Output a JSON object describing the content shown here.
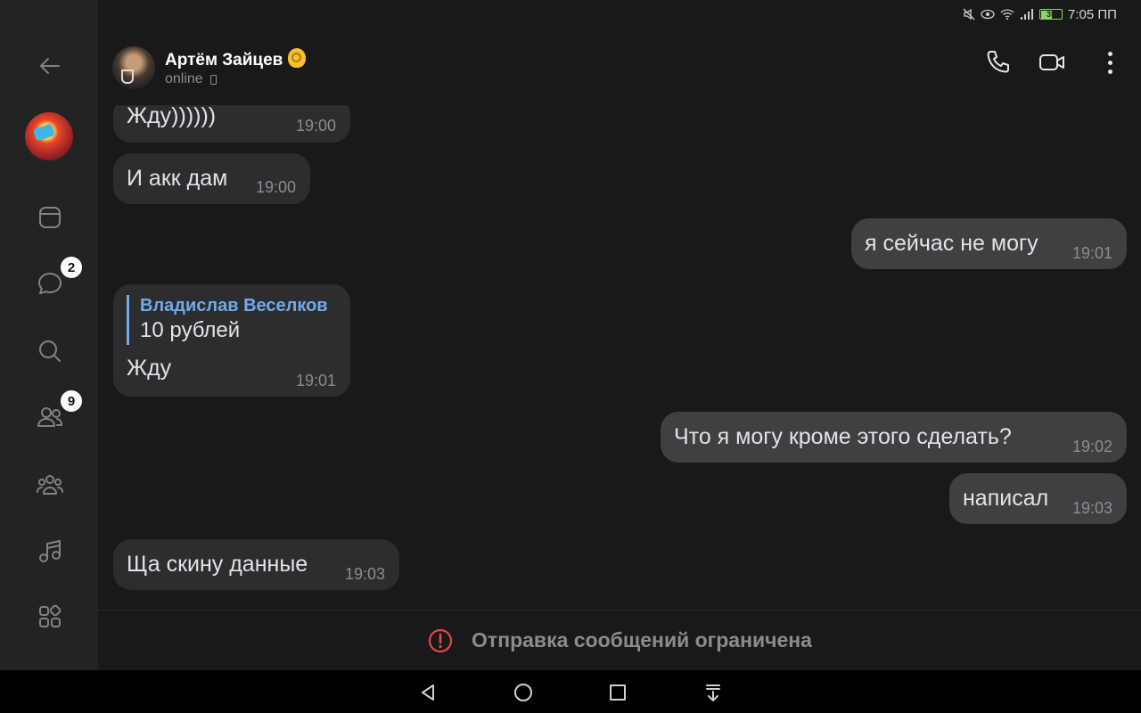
{
  "status_bar": {
    "time": "7:05 ПП",
    "battery": "35"
  },
  "header": {
    "name": "Артём Зайцев",
    "status": "online",
    "emoji_icon": "ok-hand-icon"
  },
  "rail": {
    "items": [
      {
        "icon": "back-arrow-icon"
      },
      {
        "icon": "profile-avatar"
      },
      {
        "icon": "news-feed-icon"
      },
      {
        "icon": "messages-icon",
        "badge": "2"
      },
      {
        "icon": "search-icon"
      },
      {
        "icon": "friends-icon",
        "badge": "9"
      },
      {
        "icon": "communities-icon"
      },
      {
        "icon": "music-icon"
      },
      {
        "icon": "services-icon"
      }
    ]
  },
  "messages": [
    {
      "dir": "in",
      "text": "Жду))))))",
      "time": "19:00"
    },
    {
      "dir": "in",
      "text": "И акк дам",
      "time": "19:00"
    },
    {
      "dir": "out",
      "text": "я сейчас не могу",
      "time": "19:01"
    },
    {
      "dir": "in",
      "reply_name": "Владислав Веселков",
      "reply_text": "10 рублей",
      "text": "Жду",
      "time": "19:01"
    },
    {
      "dir": "out",
      "text": "Что я могу кроме этого сделать?",
      "time": "19:02"
    },
    {
      "dir": "out",
      "text": "написал",
      "time": "19:03"
    },
    {
      "dir": "in",
      "text": "Ща скину данные",
      "time": "19:03"
    }
  ],
  "restriction": {
    "text": "Отправка сообщений ограничена"
  },
  "colors": {
    "accent": "#71aaeb",
    "warning": "#e64646",
    "background": "#19191a"
  }
}
